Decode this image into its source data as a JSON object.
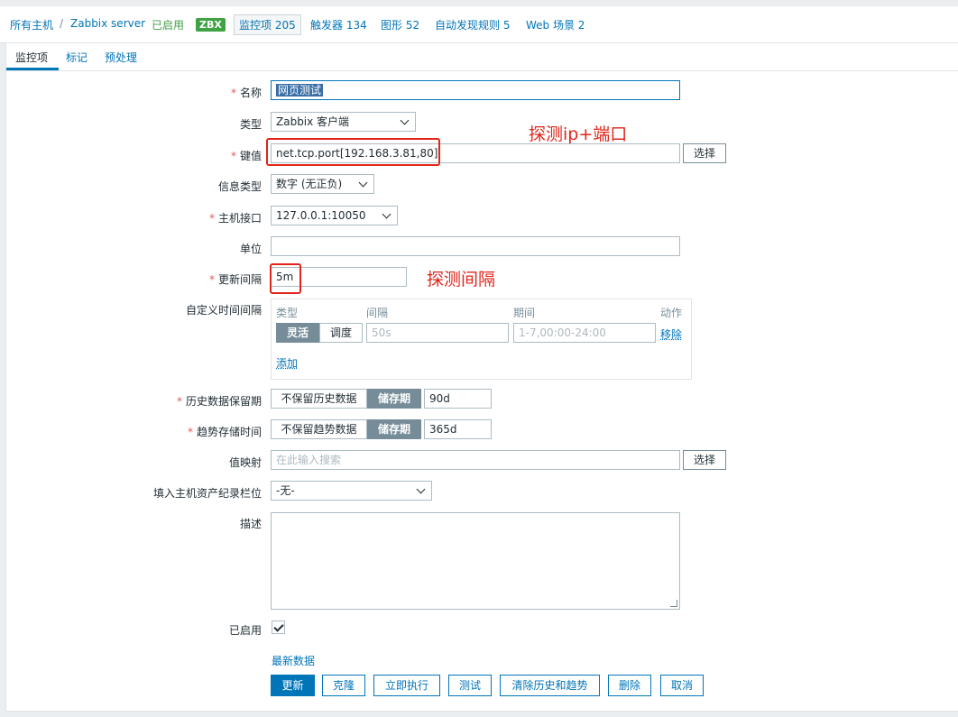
{
  "breadcrumb": {
    "all_hosts": "所有主机",
    "separator": "/",
    "host": "Zabbix server",
    "status": "已启用",
    "zbx_badge": "ZBX",
    "items": "监控项 205",
    "triggers": "触发器 134",
    "graphs": "图形 52",
    "discovery": "自动发现规则 5",
    "web": "Web 场景 2"
  },
  "tabs": [
    {
      "label": "监控项",
      "active": true
    },
    {
      "label": "标记",
      "active": false
    },
    {
      "label": "预处理",
      "active": false
    }
  ],
  "form": {
    "name_label": "名称",
    "name_value": "网页测试",
    "type_label": "类型",
    "type_value": "Zabbix 客户端",
    "key_label": "键值",
    "key_value": "net.tcp.port[192.168.3.81,80]",
    "select_label": "选择",
    "info_type_label": "信息类型",
    "info_type_value": "数字 (无正负)",
    "host_interface_label": "主机接口",
    "host_interface_value": "127.0.0.1:10050",
    "units_label": "单位",
    "units_value": "",
    "update_interval_label": "更新间隔",
    "update_interval_value": "5m",
    "custom_intervals_label": "自定义时间间隔",
    "custom_intervals": {
      "col_type": "类型",
      "col_interval": "间隔",
      "col_period": "期间",
      "col_action": "动作",
      "flexible": "灵活",
      "scheduling": "调度",
      "interval_placeholder": "50s",
      "period_placeholder": "1-7,00:00-24:00",
      "remove": "移除",
      "add": "添加"
    },
    "history_label": "历史数据保留期",
    "history_no_keep": "不保留历史数据",
    "history_storage": "储存期",
    "history_value": "90d",
    "trends_label": "趋势存储时间",
    "trends_no_keep": "不保留趋势数据",
    "trends_storage": "储存期",
    "trends_value": "365d",
    "value_map_label": "值映射",
    "value_map_placeholder": "在此输入搜索",
    "inventory_label": "填入主机资产纪录栏位",
    "inventory_value": "-无-",
    "description_label": "描述",
    "enabled_label": "已启用",
    "latest_data_link": "最新数据"
  },
  "buttons": {
    "update": "更新",
    "clone": "克隆",
    "execute_now": "立即执行",
    "test": "测试",
    "clear_history": "清除历史和趋势",
    "delete": "删除",
    "cancel": "取消"
  },
  "annotations": {
    "key_note": "探测ip+端口",
    "interval_note": "探测间隔"
  },
  "colors": {
    "accent": "#0275b8",
    "annotation": "#e1251b",
    "enabled_green": "#429e47"
  }
}
